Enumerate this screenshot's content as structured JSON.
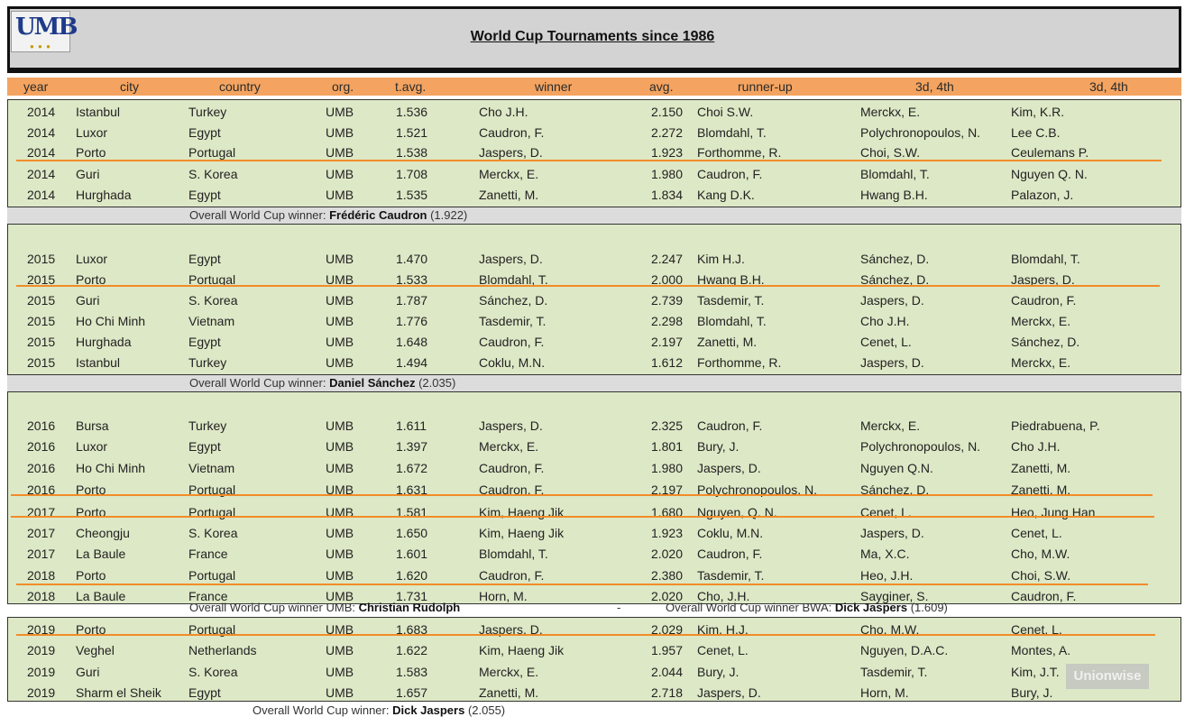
{
  "title": "World Cup Tournaments since 1986",
  "logo_text": "UMB",
  "watermark": "Unionwise",
  "columns": [
    "year",
    "city",
    "country",
    "org.",
    "t.avg.",
    "winner",
    "avg.",
    "runner-up",
    "3d, 4th",
    "3d, 4th"
  ],
  "blocks": [
    {
      "rows": [
        [
          "2014",
          "Istanbul",
          "Turkey",
          "UMB",
          "1.536",
          "Cho J.H.",
          "2.150",
          "Choi S.W.",
          "Merckx, E.",
          "Kim, K.R."
        ],
        [
          "2014",
          "Luxor",
          "Egypt",
          "UMB",
          "1.521",
          "Caudron, F.",
          "2.272",
          "Blomdahl, T.",
          "Polychronopoulos, N.",
          "Lee C.B."
        ],
        [
          "2014",
          "Porto",
          "Portugal",
          "UMB",
          "1.538",
          "Jaspers, D.",
          "1.923",
          "Forthomme, R.",
          "Choi, S.W.",
          "Ceulemans P."
        ],
        [
          "2014",
          "Guri",
          "S. Korea",
          "UMB",
          "1.708",
          "Merckx, E.",
          "1.980",
          "Caudron, F.",
          "Blomdahl, T.",
          "Nguyen Q. N."
        ],
        [
          "2014",
          "Hurghada",
          "Egypt",
          "UMB",
          "1.535",
          "Zanetti, M.",
          "1.834",
          "Kang D.K.",
          "Hwang B.H.",
          "Palazon, J."
        ]
      ],
      "overall_prefix": "Overall World Cup winner: ",
      "overall_name": "Frédéric Caudron",
      "overall_suffix": " (1.922)"
    },
    {
      "rows": [
        [
          "2015",
          "Luxor",
          "Egypt",
          "UMB",
          "1.470",
          "Jaspers, D.",
          "2.247",
          "Kim H.J.",
          "Sánchez, D.",
          "Blomdahl, T."
        ],
        [
          "2015",
          "Porto",
          "Portugal",
          "UMB",
          "1.533",
          "Blomdahl, T.",
          "2.000",
          "Hwang B.H.",
          "Sánchez, D.",
          "Jaspers, D."
        ],
        [
          "2015",
          "Guri",
          "S. Korea",
          "UMB",
          "1.787",
          "Sánchez, D.",
          "2.739",
          "Tasdemir, T.",
          "Jaspers, D.",
          "Caudron, F."
        ],
        [
          "2015",
          "Ho Chi Minh",
          "Vietnam",
          "UMB",
          "1.776",
          "Tasdemir, T.",
          "2.298",
          "Blomdahl, T.",
          "Cho J.H.",
          "Merckx, E."
        ],
        [
          "2015",
          "Hurghada",
          "Egypt",
          "UMB",
          "1.648",
          "Caudron, F.",
          "2.197",
          "Zanetti, M.",
          "Cenet, L.",
          "Sánchez, D."
        ],
        [
          "2015",
          "Istanbul",
          "Turkey",
          "UMB",
          "1.494",
          "Coklu, M.N.",
          "1.612",
          "Forthomme, R.",
          "Jaspers, D.",
          "Merckx, E."
        ]
      ],
      "overall_prefix": "Overall World Cup winner: ",
      "overall_name": "Daniel Sánchez",
      "overall_suffix": " (2.035)"
    },
    {
      "rows": [
        [
          "2016",
          "Bursa",
          "Turkey",
          "UMB",
          "1.611",
          "Jaspers, D.",
          "2.325",
          "Caudron, F.",
          "Merckx, E.",
          "Piedrabuena, P."
        ],
        [
          "2016",
          "Luxor",
          "Egypt",
          "UMB",
          "1.397",
          "Merckx, E.",
          "1.801",
          "Bury, J.",
          "Polychronopoulos, N.",
          "Cho J.H."
        ],
        [
          "2016",
          "Ho Chi Minh",
          "Vietnam",
          "UMB",
          "1.672",
          "Caudron, F.",
          "1.980",
          "Jaspers, D.",
          "Nguyen Q.N.",
          "Zanetti, M."
        ],
        [
          "2016",
          "Porto",
          "Portugal",
          "UMB",
          "1.631",
          "Caudron, F.",
          "2.197",
          "Polychronopoulos, N.",
          "Sánchez, D.",
          "Zanetti, M."
        ],
        [
          "2017",
          "Porto",
          "Portugal",
          "UMB",
          "1.581",
          "Kim, Haeng Jik",
          "1.680",
          "Nguyen, Q. N.",
          "Cenet, L.",
          "Heo, Jung Han"
        ],
        [
          "2017",
          "Cheongju",
          "S. Korea",
          "UMB",
          "1.650",
          "Kim, Haeng Jik",
          "1.923",
          "Coklu, M.N.",
          "Jaspers, D.",
          "Cenet, L."
        ],
        [
          "2017",
          "La Baule",
          "France",
          "UMB",
          "1.601",
          "Blomdahl, T.",
          "2.020",
          "Caudron, F.",
          "Ma, X.C.",
          "Cho, M.W."
        ],
        [
          "2018",
          "Porto",
          "Portugal",
          "UMB",
          "1.620",
          "Caudron, F.",
          "2.380",
          "Tasdemir, T.",
          "Heo, J.H.",
          "Choi, S.W."
        ],
        [
          "2018",
          "La Baule",
          "France",
          "UMB",
          "1.731",
          "Horn, M.",
          "2.020",
          "Cho, J.H.",
          "Sayginer, S.",
          "Caudron, F."
        ]
      ],
      "overall_umb_prefix": "Overall World Cup winner UMB: ",
      "overall_umb_name": "Christian Rudolph",
      "separator": "-",
      "overall_bwa_prefix": "Overall World Cup winner BWA: ",
      "overall_bwa_name": "Dick Jaspers",
      "overall_bwa_suffix": " (1.609)"
    },
    {
      "rows": [
        [
          "2019",
          "Porto",
          "Portugal",
          "UMB",
          "1.683",
          "Jaspers, D.",
          "2.029",
          "Kim, H.J.",
          "Cho, M.W.",
          "Cenet, L."
        ],
        [
          "2019",
          "Veghel",
          "Netherlands",
          "UMB",
          "1.622",
          "Kim, Haeng Jik",
          "1.957",
          "Cenet, L.",
          "Nguyen, D.A.C.",
          "Montes, A."
        ],
        [
          "2019",
          "Guri",
          "S. Korea",
          "UMB",
          "1.583",
          "Merckx, E.",
          "2.044",
          "Bury, J.",
          "Tasdemir, T.",
          "Kim, J.T."
        ],
        [
          "2019",
          "Sharm el Sheik",
          "Egypt",
          "UMB",
          "1.657",
          "Zanetti, M.",
          "2.718",
          "Jaspers, D.",
          "Horn, M.",
          "Bury, J."
        ]
      ],
      "overall_prefix": "Overall World Cup winner: ",
      "overall_name": "Dick Jaspers",
      "overall_suffix": " (2.055)"
    }
  ],
  "colors": {
    "header_bg": "#f4a460",
    "row_bg": "#dde8c6",
    "highlight_line": "#f28c28",
    "title_bg": "#d3d3d3"
  }
}
